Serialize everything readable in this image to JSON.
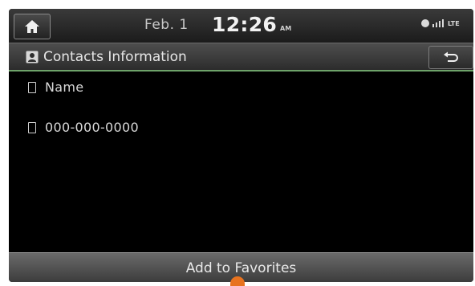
{
  "status": {
    "date": "Feb. 1",
    "time": "12:26",
    "ampm": "AM",
    "network": "LTE"
  },
  "header": {
    "title": "Contacts Information"
  },
  "contact": {
    "name": "Name",
    "phone": "000-000-0000"
  },
  "actions": {
    "add_favorites": "Add to Favorites"
  }
}
